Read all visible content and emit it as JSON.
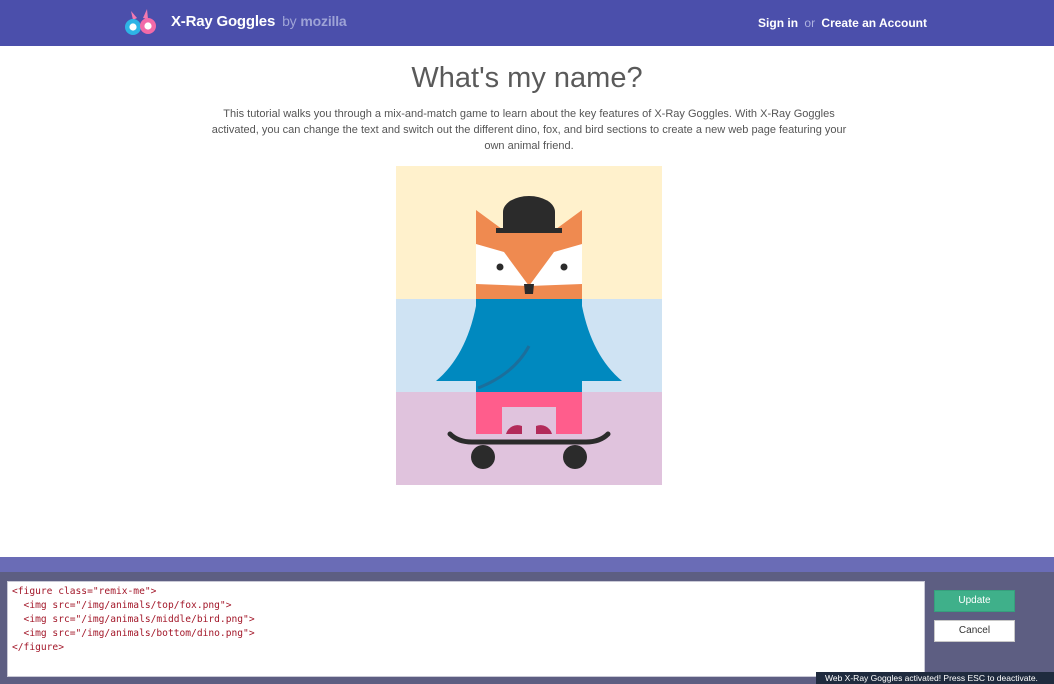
{
  "header": {
    "brand_name": "X-Ray Goggles",
    "brand_by": "by",
    "brand_org": "mozilla",
    "sign_in": "Sign in",
    "or": "or",
    "create_account": "Create an Account",
    "bg_color": "#4b4fab"
  },
  "main": {
    "title": "What's my name?",
    "description": "This tutorial walks you through a mix-and-match game to learn about the key features of X-Ray Goggles. With X-Ray Goggles activated, you can change the text and switch out the different dino, fox, and bird sections to create a new web page featuring your own animal friend.",
    "figure": {
      "top_image": "fox",
      "middle_image": "bird",
      "bottom_image": "dino",
      "colors": {
        "top_bg": "#fff1cc",
        "middle_bg": "#cfe3f3",
        "bottom_bg": "#e0c3dd",
        "fox": "#ef8a50",
        "bird": "#0089bf",
        "pants": "#ff5d8c"
      }
    }
  },
  "editor": {
    "code": "<figure class=\"remix-me\">\n  <img src=\"/img/animals/top/fox.png\">\n  <img src=\"/img/animals/middle/bird.png\">\n  <img src=\"/img/animals/bottom/dino.png\">\n</figure>",
    "update_label": "Update",
    "cancel_label": "Cancel",
    "accent": "#3fb08a"
  },
  "status_bar": {
    "text": "Web X-Ray Goggles activated! Press ESC to deactivate."
  }
}
